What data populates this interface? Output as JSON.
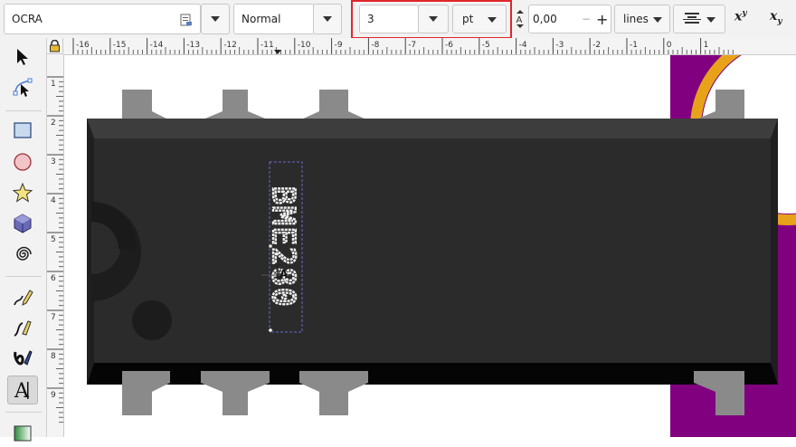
{
  "toolbar": {
    "font_family": "OCRA",
    "font_style": "Normal",
    "font_size": "3",
    "font_unit": "pt",
    "line_spacing": "0,00",
    "spacing_minus": "−",
    "spacing_plus": "+",
    "line_mode": "lines",
    "superscript": "x",
    "superscript_mark": "y",
    "subscript": "x",
    "subscript_mark": "y"
  },
  "rulers": {
    "horizontal_labels": [
      "-16",
      "-15",
      "-14",
      "-13",
      "-12",
      "-11",
      "-10",
      "-9",
      "-8",
      "-7",
      "-6",
      "-5",
      "-4",
      "-3",
      "-2",
      "-1",
      "0",
      "1"
    ],
    "vertical_labels": [
      "1",
      "2",
      "3",
      "4",
      "5",
      "6",
      "7",
      "8",
      "9"
    ]
  },
  "canvas": {
    "chip_text": "BME280"
  },
  "tools": [
    {
      "name": "selector-tool-icon"
    },
    {
      "name": "node-tool-icon"
    },
    {
      "name": "rectangle-tool-icon"
    },
    {
      "name": "circle-tool-icon"
    },
    {
      "name": "star-tool-icon"
    },
    {
      "name": "box3d-tool-icon"
    },
    {
      "name": "spiral-tool-icon"
    },
    {
      "name": "pencil-tool-icon"
    },
    {
      "name": "pen-tool-icon"
    },
    {
      "name": "calligraphy-tool-icon"
    },
    {
      "name": "text-tool-icon"
    },
    {
      "name": "gradient-tool-icon"
    }
  ],
  "colors": {
    "highlight": "#e0262b",
    "chip_body": "#2b2b2b",
    "chip_top": "#3d3d3d",
    "chip_bottom": "#050505",
    "pins": "#8a8a8a",
    "accent_purple": "#800080",
    "accent_orange": "#e8a21a"
  }
}
